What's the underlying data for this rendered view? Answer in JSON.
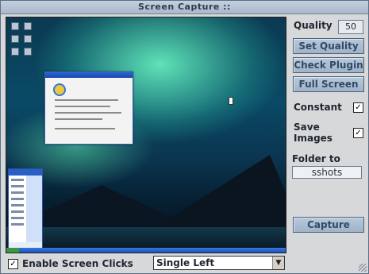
{
  "window": {
    "title": "Screen Capture ::"
  },
  "settings": {
    "quality_label": "Quality",
    "quality_value": "50",
    "buttons": {
      "set_quality": "Set Quality",
      "check_plugin": "Check Plugin",
      "full_screen": "Full Screen",
      "capture": "Capture"
    },
    "constant_label": "Constant",
    "constant_checked": true,
    "save_images_label": "Save Images",
    "save_images_checked": true,
    "folder_label": "Folder to save",
    "folder_value": "sshots"
  },
  "footer": {
    "enable_clicks_label": "Enable Screen Clicks",
    "enable_clicks_checked": true,
    "click_mode_selected": "Single Left"
  },
  "icons": {
    "check": "check-icon",
    "dropdown": "chevron-down-icon",
    "grip": "resize-grip-icon"
  }
}
